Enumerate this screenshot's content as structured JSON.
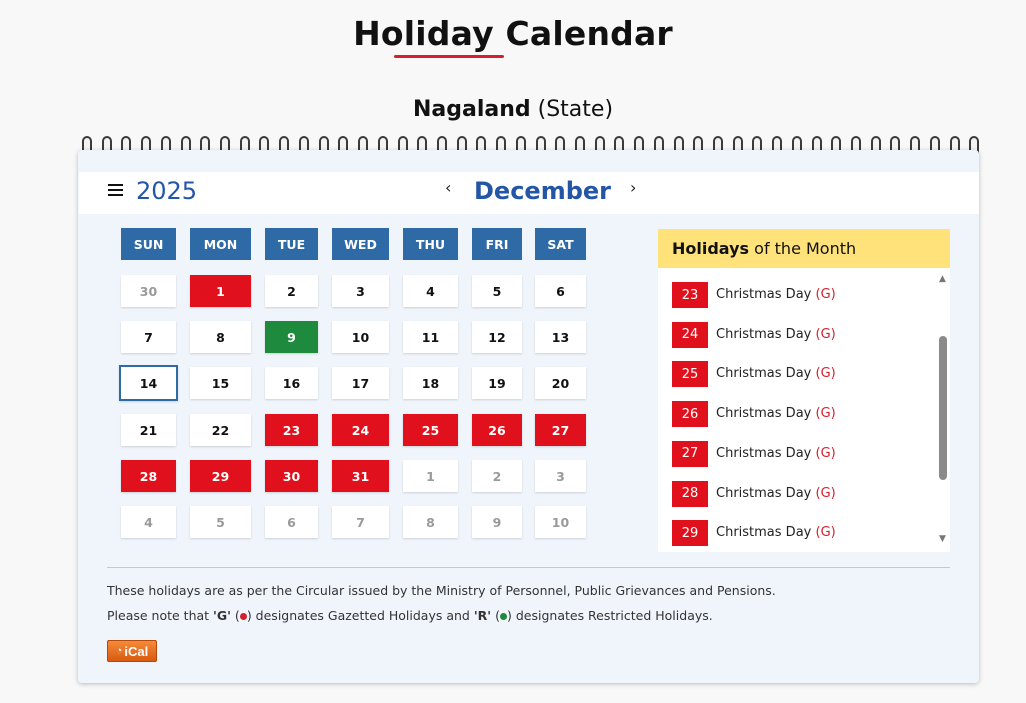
{
  "page": {
    "title": "Holiday Calendar",
    "state_name": "Nagaland",
    "state_type": "(State)"
  },
  "calendar": {
    "year": "2025",
    "month": "December",
    "prev_icon": "‹",
    "next_icon": "›",
    "weekdays": [
      "SUN",
      "MON",
      "TUE",
      "WED",
      "THU",
      "FRI",
      "SAT"
    ],
    "weeks": [
      [
        {
          "d": "30",
          "t": "muted"
        },
        {
          "d": "1",
          "t": "gaz"
        },
        {
          "d": "2"
        },
        {
          "d": "3"
        },
        {
          "d": "4"
        },
        {
          "d": "5"
        },
        {
          "d": "6"
        }
      ],
      [
        {
          "d": "7"
        },
        {
          "d": "8"
        },
        {
          "d": "9",
          "t": "res"
        },
        {
          "d": "10"
        },
        {
          "d": "11"
        },
        {
          "d": "12"
        },
        {
          "d": "13"
        }
      ],
      [
        {
          "d": "14",
          "t": "today"
        },
        {
          "d": "15"
        },
        {
          "d": "16"
        },
        {
          "d": "17"
        },
        {
          "d": "18"
        },
        {
          "d": "19"
        },
        {
          "d": "20"
        }
      ],
      [
        {
          "d": "21"
        },
        {
          "d": "22"
        },
        {
          "d": "23",
          "t": "gaz"
        },
        {
          "d": "24",
          "t": "gaz"
        },
        {
          "d": "25",
          "t": "gaz"
        },
        {
          "d": "26",
          "t": "gaz"
        },
        {
          "d": "27",
          "t": "gaz"
        }
      ],
      [
        {
          "d": "28",
          "t": "gaz"
        },
        {
          "d": "29",
          "t": "gaz"
        },
        {
          "d": "30",
          "t": "gaz"
        },
        {
          "d": "31",
          "t": "gaz"
        },
        {
          "d": "1",
          "t": "muted"
        },
        {
          "d": "2",
          "t": "muted"
        },
        {
          "d": "3",
          "t": "muted"
        }
      ],
      [
        {
          "d": "4",
          "t": "muted"
        },
        {
          "d": "5",
          "t": "muted"
        },
        {
          "d": "6",
          "t": "muted"
        },
        {
          "d": "7",
          "t": "muted"
        },
        {
          "d": "8",
          "t": "muted"
        },
        {
          "d": "9",
          "t": "muted"
        },
        {
          "d": "10",
          "t": "muted"
        }
      ]
    ]
  },
  "holidays": {
    "header_bold": "Holidays",
    "header_rest": " of the Month",
    "items": [
      {
        "date": "23",
        "name": "Christmas Day",
        "tag": "(G)"
      },
      {
        "date": "24",
        "name": "Christmas Day",
        "tag": "(G)"
      },
      {
        "date": "25",
        "name": "Christmas Day",
        "tag": "(G)"
      },
      {
        "date": "26",
        "name": "Christmas Day",
        "tag": "(G)"
      },
      {
        "date": "27",
        "name": "Christmas Day",
        "tag": "(G)"
      },
      {
        "date": "28",
        "name": "Christmas Day",
        "tag": "(G)"
      },
      {
        "date": "29",
        "name": "Christmas Day",
        "tag": "(G)"
      }
    ]
  },
  "notes": {
    "circular": "These holidays are as per the Circular issued by the Ministry of Personnel, Public Grievances and Pensions.",
    "legend_a": "Please note that ",
    "legend_g": "'G'",
    "legend_b": " designates Gazetted Holidays and ",
    "legend_r": "'R'",
    "legend_c": " designates Restricted Holidays."
  },
  "ical": {
    "label": "iCal",
    "icon": "rss-icon"
  },
  "colors": {
    "gazetted": "#e0101c",
    "restricted": "#1e8a3e",
    "accent": "#2456a7",
    "weekday_header": "#2e6aa6",
    "panel_header": "#ffe37a"
  }
}
